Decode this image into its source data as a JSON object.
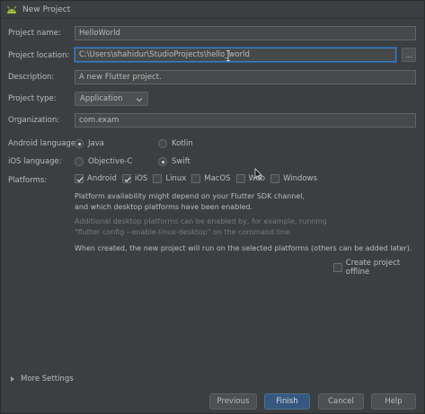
{
  "window": {
    "title": "New Project",
    "app_icon": "android-icon"
  },
  "form": {
    "project_name": {
      "label": "Project name:",
      "value": "HelloWorld"
    },
    "project_location": {
      "label": "Project location:",
      "value": "C:\\Users\\shahidur\\StudioProjects\\hello_world",
      "browse_label": "..."
    },
    "description": {
      "label": "Description:",
      "value": "A new Flutter project."
    },
    "project_type": {
      "label": "Project type:",
      "value": "Application"
    },
    "organization": {
      "label": "Organization:",
      "value": "com.exam"
    },
    "android_language": {
      "label": "Android language:",
      "options": [
        {
          "label": "Java",
          "selected": true
        },
        {
          "label": "Kotlin",
          "selected": false
        }
      ]
    },
    "ios_language": {
      "label": "iOS language:",
      "options": [
        {
          "label": "Objective-C",
          "selected": false
        },
        {
          "label": "Swift",
          "selected": true
        }
      ]
    },
    "platforms": {
      "label": "Platforms:",
      "items": [
        {
          "label": "Android",
          "checked": true
        },
        {
          "label": "iOS",
          "checked": true
        },
        {
          "label": "Linux",
          "checked": false
        },
        {
          "label": "MacOS",
          "checked": false
        },
        {
          "label": "Web",
          "checked": false
        },
        {
          "label": "Windows",
          "checked": false
        }
      ]
    }
  },
  "notes": {
    "availability_line1": "Platform availability might depend on your Flutter SDK channel,",
    "availability_line2": "and which desktop platforms have been enabled.",
    "desktop_line1": "Additional desktop platforms can be enabled by, for example, running",
    "desktop_line2": "\"flutter config --enable-linux-desktop\" on the command line.",
    "created_line": "When created, the new project will run on the selected platforms (others can be added later)."
  },
  "create_offline": {
    "label": "Create project offline",
    "checked": false
  },
  "more_settings": {
    "label": "More Settings"
  },
  "buttons": {
    "previous": "Previous",
    "finish": "Finish",
    "cancel": "Cancel",
    "help": "Help"
  },
  "colors": {
    "background": "#3c3f41",
    "field_background": "#45494a",
    "focus_border": "#3d7fc2",
    "primary_button": "#365880",
    "android_green": "#a4c639"
  }
}
